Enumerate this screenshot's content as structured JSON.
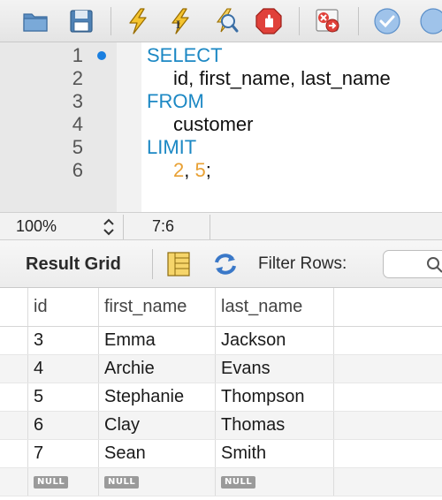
{
  "toolbar": {
    "buttons": [
      {
        "name": "open-folder-icon"
      },
      {
        "name": "save-icon"
      },
      {
        "name": "execute-icon"
      },
      {
        "name": "execute-current-icon"
      },
      {
        "name": "explain-icon"
      },
      {
        "name": "stop-icon"
      },
      {
        "name": "toggle-continue-on-error-icon"
      },
      {
        "name": "commit-icon"
      }
    ]
  },
  "editor": {
    "line_numbers": [
      "1",
      "2",
      "3",
      "4",
      "5",
      "6"
    ],
    "lines": {
      "l1_kw": "SELECT",
      "l2": "id, first_name, last_name",
      "l3_kw": "FROM",
      "l4": "customer",
      "l5_kw": "LIMIT",
      "l6_a": "2",
      "l6_comma": ", ",
      "l6_b": "5",
      "l6_end": ";"
    },
    "colors": {
      "keyword": "#1c88c4",
      "number": "#e8a033",
      "breakpoint": "#1a7fe0"
    }
  },
  "status_bar": {
    "zoom": "100%",
    "cursor_position": "7:6"
  },
  "result_grid": {
    "title": "Result Grid",
    "filter_label": "Filter Rows:",
    "search_placeholder": "",
    "columns": [
      "id",
      "first_name",
      "last_name"
    ],
    "rows": [
      [
        "3",
        "Emma",
        "Jackson"
      ],
      [
        "4",
        "Archie",
        "Evans"
      ],
      [
        "5",
        "Stephanie",
        "Thompson"
      ],
      [
        "6",
        "Clay",
        "Thomas"
      ],
      [
        "7",
        "Sean",
        "Smith"
      ]
    ],
    "null_label": "NULL"
  }
}
